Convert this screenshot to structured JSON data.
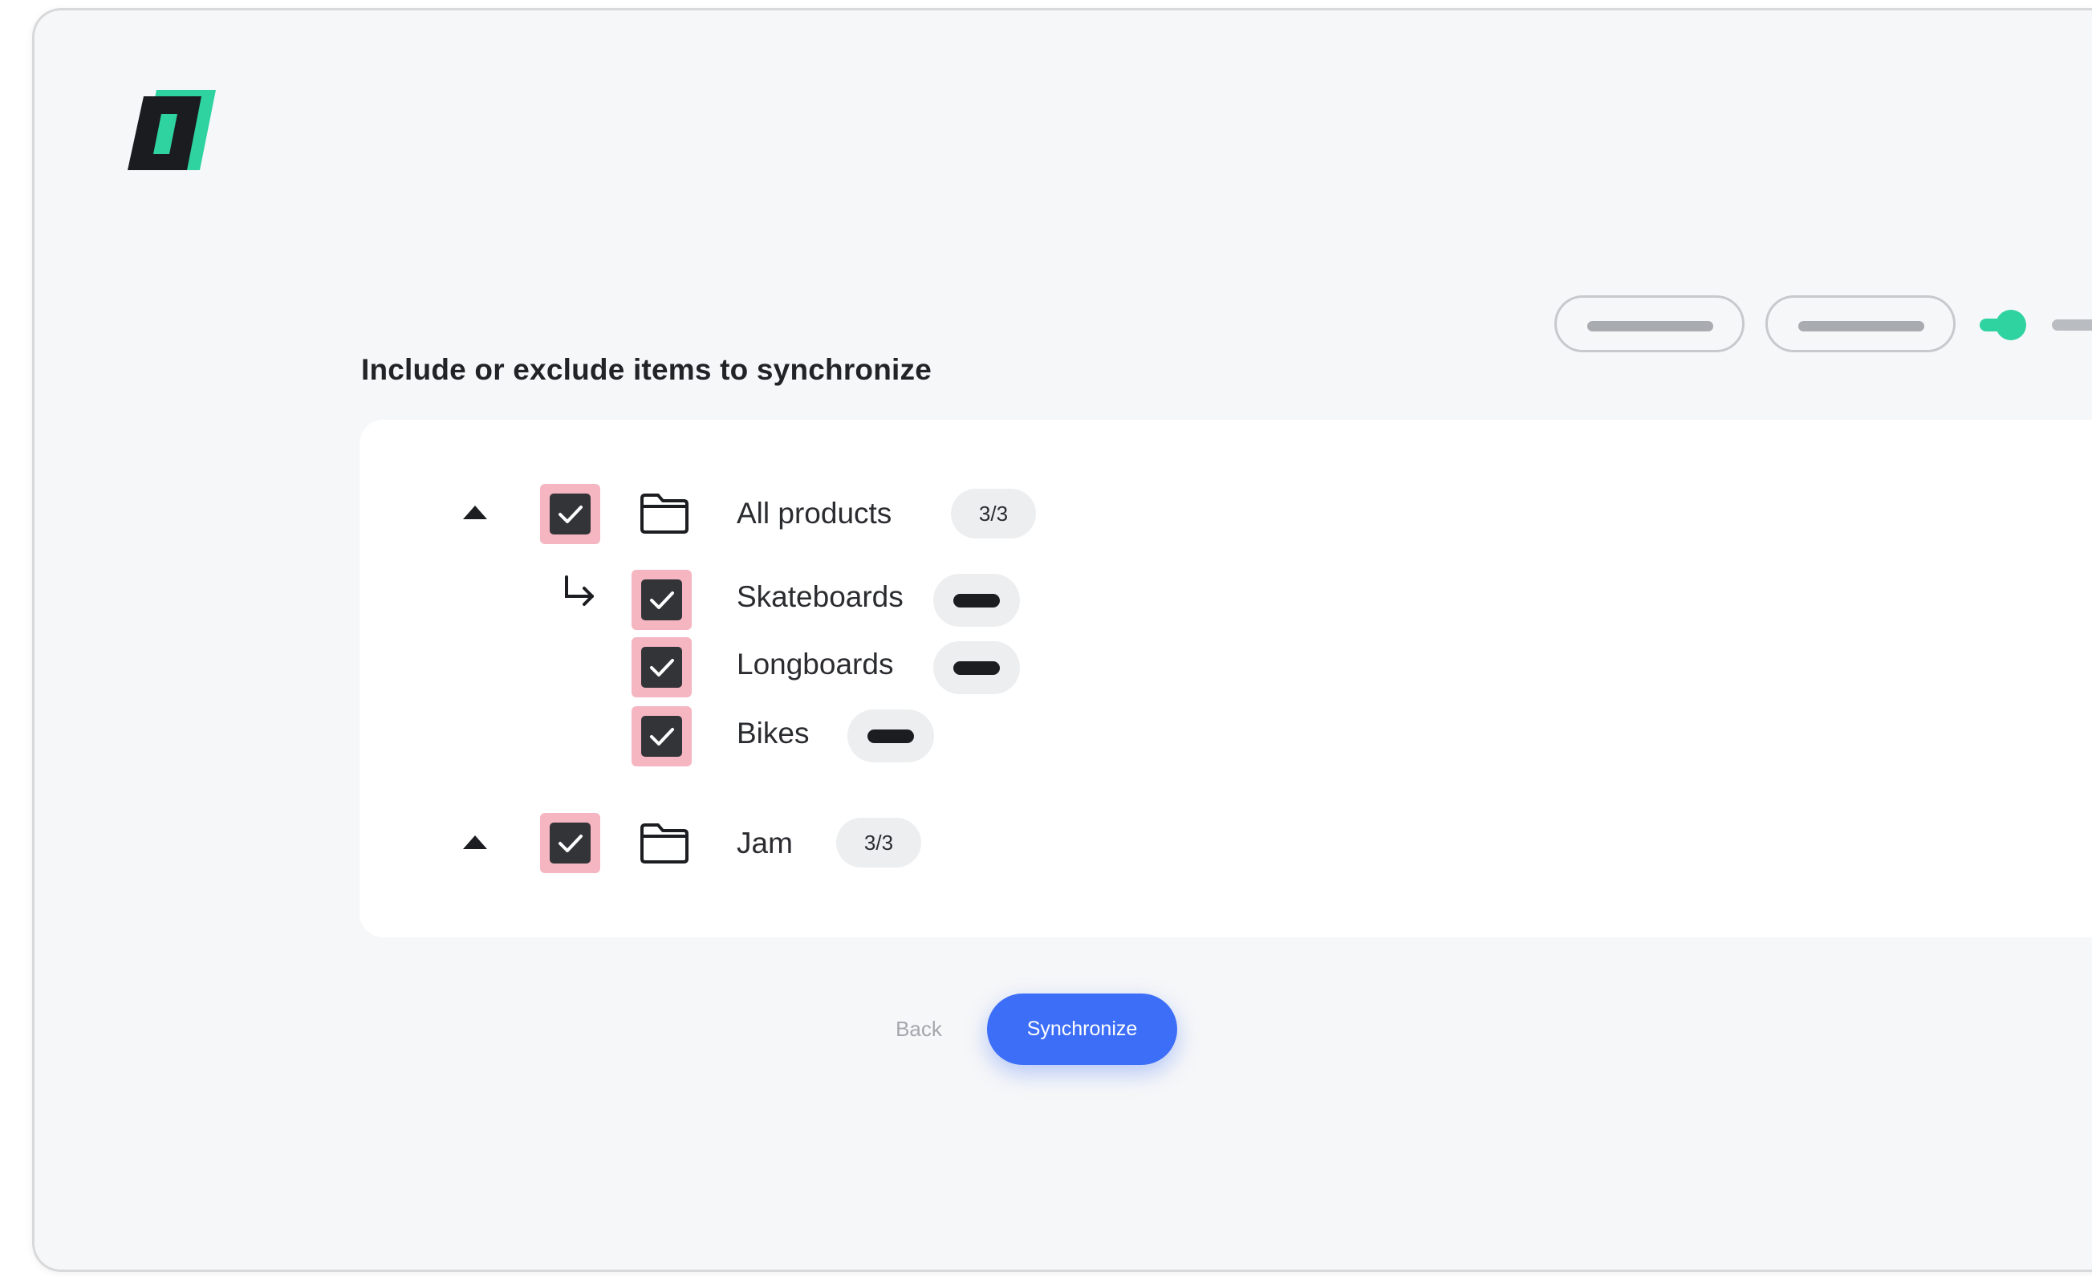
{
  "header": {
    "logo_icon": "brand-logo-icon"
  },
  "stepper": {
    "accent_color": "#2ed3a0"
  },
  "section": {
    "title": "Include or exclude items to synchronize"
  },
  "tree": {
    "groups": [
      {
        "label": "All products",
        "count": "3/3",
        "checked": true,
        "expanded": true,
        "children": [
          {
            "label": "Skateboards",
            "checked": true
          },
          {
            "label": "Longboards",
            "checked": true
          },
          {
            "label": "Bikes",
            "checked": true
          }
        ]
      },
      {
        "label": "Jam",
        "count": "3/3",
        "checked": true,
        "expanded": true,
        "children": []
      }
    ]
  },
  "actions": {
    "back_label": "Back",
    "synchronize_label": "Synchronize",
    "primary_color": "#3d6ef7"
  }
}
